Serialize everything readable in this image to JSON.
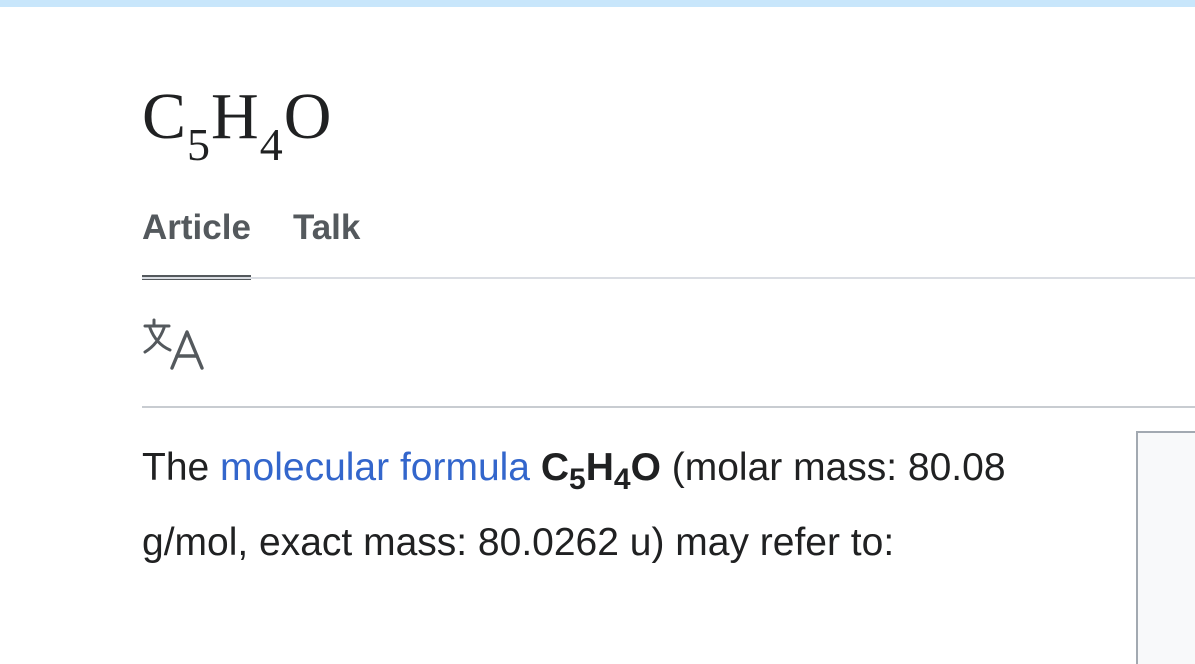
{
  "title": {
    "c": "C",
    "c_sub": "5",
    "h": "H",
    "h_sub": "4",
    "o": "O"
  },
  "tabs": [
    {
      "label": "Article",
      "active": true
    },
    {
      "label": "Talk",
      "active": false
    }
  ],
  "language_icon": "translate-icon",
  "lead": {
    "prefix": "The ",
    "link_text": "molecular formula",
    "space1": " ",
    "formula": {
      "c": "C",
      "c_sub": "5",
      "h": "H",
      "h_sub": "4",
      "o": "O"
    },
    "suffix": " (molar mass: 80.08 g/mol, exact mass: 80.0262 u) may refer to:"
  },
  "colors": {
    "link": "#3366cc",
    "top_strip": "#c8e6fb",
    "tab_text": "#54595d"
  }
}
